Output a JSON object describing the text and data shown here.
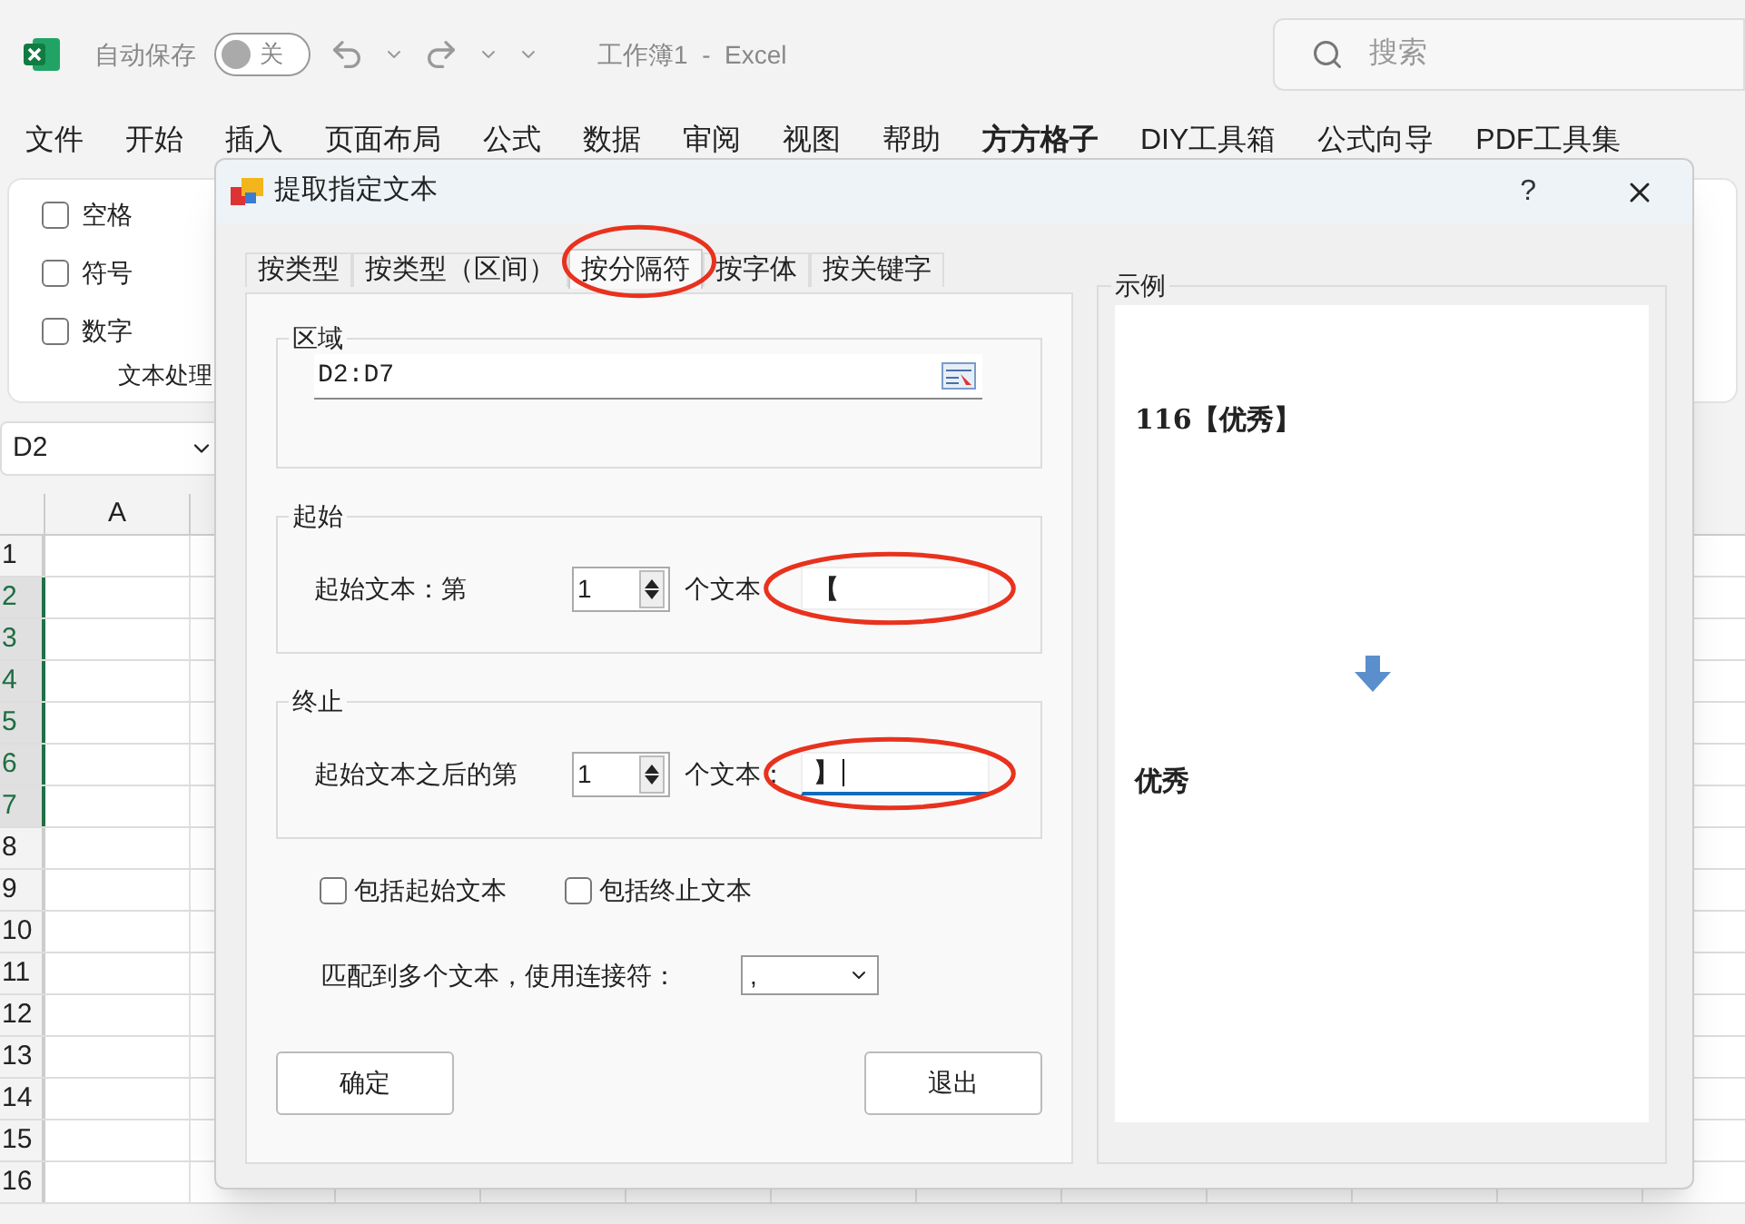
{
  "titlebar": {
    "autosave_label": "自动保存",
    "autosave_toggle": {
      "on": false,
      "label": "关"
    },
    "title": "工作簿1  -  Excel",
    "search": {
      "placeholder": "搜索"
    }
  },
  "menu": [
    {
      "label": "文件",
      "selected": false
    },
    {
      "label": "开始",
      "selected": false
    },
    {
      "label": "插入",
      "selected": false
    },
    {
      "label": "页面布局",
      "selected": false
    },
    {
      "label": "公式",
      "selected": false
    },
    {
      "label": "数据",
      "selected": false
    },
    {
      "label": "审阅",
      "selected": false
    },
    {
      "label": "视图",
      "selected": false
    },
    {
      "label": "帮助",
      "selected": false
    },
    {
      "label": "方方格子",
      "selected": true
    },
    {
      "label": "DIY工具箱",
      "selected": false
    },
    {
      "label": "公式向导",
      "selected": false
    },
    {
      "label": "PDF工具集",
      "selected": false
    }
  ],
  "ribbon": {
    "checkboxes": [
      {
        "label": "空格",
        "checked": false
      },
      {
        "label": "符号",
        "checked": false
      },
      {
        "label": "数字",
        "checked": false
      }
    ],
    "group_label": "文本处理"
  },
  "name_box": {
    "value": "D2"
  },
  "sheet": {
    "columns": [
      "A"
    ],
    "rows": [
      {
        "label": "1",
        "selected": false
      },
      {
        "label": "2",
        "selected": true
      },
      {
        "label": "3",
        "selected": true
      },
      {
        "label": "4",
        "selected": true
      },
      {
        "label": "5",
        "selected": true
      },
      {
        "label": "6",
        "selected": true
      },
      {
        "label": "7",
        "selected": true
      },
      {
        "label": "8",
        "selected": false
      },
      {
        "label": "9",
        "selected": false
      },
      {
        "label": "10",
        "selected": false
      },
      {
        "label": "11",
        "selected": false
      },
      {
        "label": "12",
        "selected": false
      },
      {
        "label": "13",
        "selected": false
      },
      {
        "label": "14",
        "selected": false
      },
      {
        "label": "15",
        "selected": false
      },
      {
        "label": "16",
        "selected": false
      }
    ]
  },
  "dialog": {
    "title": "提取指定文本",
    "help": "?",
    "tabs": [
      {
        "label": "按类型",
        "selected": false,
        "circled": false
      },
      {
        "label": "按类型（区间）",
        "selected": false,
        "circled": false
      },
      {
        "label": "按分隔符",
        "selected": true,
        "circled": true
      },
      {
        "label": "按字体",
        "selected": false,
        "circled": false
      },
      {
        "label": "按关键字",
        "selected": false,
        "circled": false
      }
    ],
    "area": {
      "legend": "区域",
      "value": "D2:D7"
    },
    "start": {
      "legend": "起始",
      "label": "起始文本：第",
      "count": "1",
      "unit": "个文本",
      "value": "【",
      "focused": false,
      "circled": true
    },
    "end": {
      "legend": "终止",
      "label": "起始文本之后的第",
      "count": "1",
      "unit": "个文本：",
      "value": "】",
      "focused": true,
      "circled": true
    },
    "options": [
      {
        "label": "包括起始文本",
        "checked": false
      },
      {
        "label": "包括终止文本",
        "checked": false
      }
    ],
    "joiner": {
      "label": "匹配到多个文本，使用连接符：",
      "value": ","
    },
    "buttons": [
      "确定",
      "退出"
    ],
    "example": {
      "legend": "示例",
      "input": "116【优秀】",
      "output": "优秀"
    }
  }
}
